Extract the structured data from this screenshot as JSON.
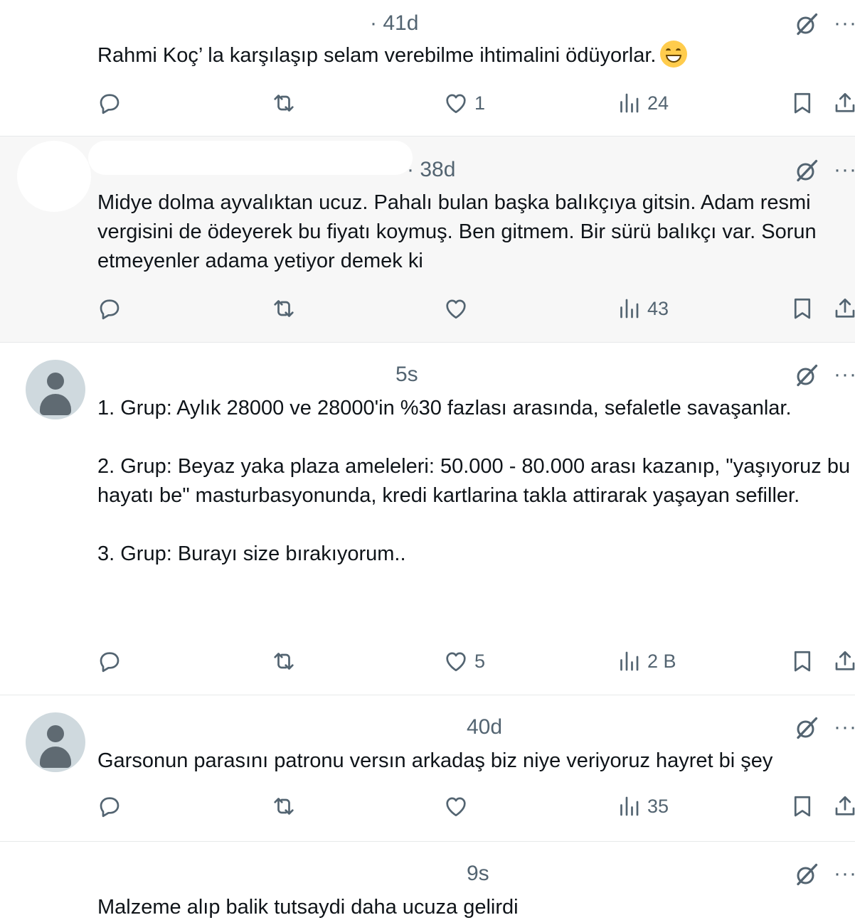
{
  "posts": [
    {
      "time": "· 41d",
      "text": "Rahmi Koç’ la karşılaşıp selam verebilme ihtimalini ödüyorlar.",
      "emoji": "grinning-face-emoji",
      "likes": "1",
      "views": "24"
    },
    {
      "time": "· 38d",
      "text": "Midye dolma ayvalıktan ucuz. Pahalı bulan başka balıkçıya gitsin. Adam resmi vergisini de ödeyerek bu fiyatı koymuş. Ben gitmem. Bir sürü balıkçı var. Sorun etmeyenler adama yetiyor demek ki",
      "likes": "",
      "views": "43"
    },
    {
      "time": "5s",
      "text": "1. Grup: Aylık 28000 ve 28000'in %30 fazlası arasında, sefaletle savaşanlar.\n\n2. Grup: Beyaz yaka plaza ameleleri: 50.000 - 80.000 arası kazanıp, \"yaşıyoruz bu hayatı be\" masturbasyonunda, kredi kartlarina takla attirarak yaşayan sefiller.\n\n3. Grup: Burayı size bırakıyorum..",
      "likes": "5",
      "views": "2 B"
    },
    {
      "time": "40d",
      "text": "Garsonun parasını patronu versın arkadaş biz niye veriyoruz hayret bi şey",
      "likes": "",
      "views": "35"
    },
    {
      "time": "9s",
      "text": "Malzeme alıp balik tutsaydi daha ucuza gelirdi"
    }
  ],
  "more_label": "···",
  "icons": {
    "reply": "reply-icon",
    "repost": "repost-icon",
    "like": "heart-icon",
    "views": "views-icon",
    "bookmark": "bookmark-icon",
    "share": "share-icon",
    "grok": "grok-icon"
  },
  "colors": {
    "muted": "#536471",
    "text": "#0f1419",
    "avatar_bg": "#cfd9de"
  }
}
